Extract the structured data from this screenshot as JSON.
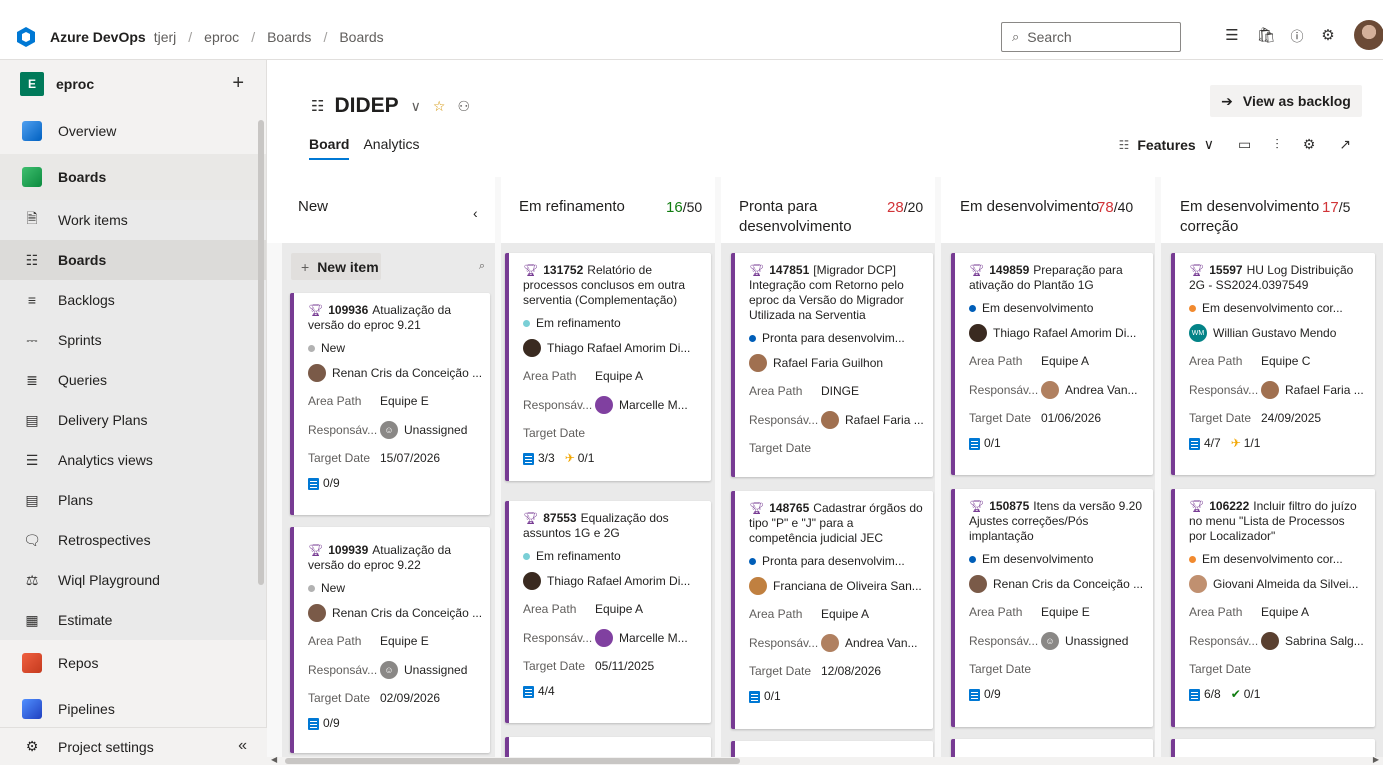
{
  "topbar": {
    "brand": "Azure DevOps",
    "breadcrumbs": [
      "tjerj",
      "eproc",
      "Boards",
      "Boards"
    ],
    "separator": "/",
    "search_placeholder": "Search"
  },
  "sidebar": {
    "project_badge": "E",
    "project_name": "eproc",
    "add_label": "+",
    "items": [
      {
        "label": "Overview",
        "icon": "overview-icon"
      },
      {
        "label": "Boards",
        "icon": "boards-icon"
      },
      {
        "label": "Work items",
        "icon": "work-items-icon"
      },
      {
        "label": "Boards",
        "icon": "boards-board-icon"
      },
      {
        "label": "Backlogs",
        "icon": "backlogs-icon"
      },
      {
        "label": "Sprints",
        "icon": "sprints-icon"
      },
      {
        "label": "Queries",
        "icon": "queries-icon"
      },
      {
        "label": "Delivery Plans",
        "icon": "delivery-plans-icon"
      },
      {
        "label": "Analytics views",
        "icon": "analytics-views-icon"
      },
      {
        "label": "Plans",
        "icon": "plans-icon"
      },
      {
        "label": "Retrospectives",
        "icon": "retrospectives-icon"
      },
      {
        "label": "Wiql Playground",
        "icon": "wiql-icon"
      },
      {
        "label": "Estimate",
        "icon": "estimate-icon"
      },
      {
        "label": "Repos",
        "icon": "repos-icon"
      },
      {
        "label": "Pipelines",
        "icon": "pipelines-icon"
      }
    ],
    "project_settings": "Project settings",
    "collapse": "«"
  },
  "header": {
    "board_name": "DIDEP",
    "tabs": [
      "Board",
      "Analytics"
    ],
    "view_as_backlog": "View as backlog",
    "features_label": "Features"
  },
  "columns": [
    {
      "name": "New",
      "count": "",
      "limit": "",
      "collapse": "‹"
    },
    {
      "name": "Em refinamento",
      "count": "16",
      "limit": "/50"
    },
    {
      "name": "Pronta para desenvolvimento",
      "count": "28",
      "limit": "/20"
    },
    {
      "name": "Em desenvolvimento",
      "count": "78",
      "limit": "/40"
    },
    {
      "name": "Em desenvolvimento correção",
      "count": "17",
      "limit": "/5"
    }
  ],
  "new_item_label": "New item",
  "field_labels": {
    "area": "Area Path",
    "resp": "Responsáv...",
    "target": "Target Date"
  },
  "cards": {
    "c1": {
      "id": "109936",
      "title": "Atualização da versão do eproc 9.21",
      "state": "New",
      "assigned": "Renan Cris da Conceição ...",
      "area": "Equipe E",
      "resp": "Unassigned",
      "target": "15/07/2026",
      "tasks": "0/9"
    },
    "c2": {
      "id": "109939",
      "title": "Atualização da versão do eproc 9.22",
      "state": "New",
      "assigned": "Renan Cris da Conceição ...",
      "area": "Equipe E",
      "resp": "Unassigned",
      "target": "02/09/2026",
      "tasks": "0/9"
    },
    "c3": {
      "id": "131752",
      "title": "Relatório de processos conclusos em outra serventia (Complementação)",
      "state": "Em refinamento",
      "assigned": "Thiago Rafael Amorim Di...",
      "area": "Equipe A",
      "resp": "Marcelle M...",
      "target": "",
      "tasks": "3/3",
      "extra": "0/1"
    },
    "c4": {
      "id": "87553",
      "title": "Equalização dos assuntos 1G e 2G",
      "state": "Em refinamento",
      "assigned": "Thiago Rafael Amorim Di...",
      "area": "Equipe A",
      "resp": "Marcelle M...",
      "target": "05/11/2025",
      "tasks": "4/4"
    },
    "c5": {
      "id": "147851",
      "title": "[Migrador DCP] Integração com Retorno pelo eproc da Versão do Migrador Utilizada na Serventia",
      "state": "Pronta para desenvolvim...",
      "assigned": "Rafael Faria Guilhon",
      "area": "DINGE",
      "resp": "Rafael Faria ...",
      "target": ""
    },
    "c6": {
      "id": "148765",
      "title": "Cadastrar órgãos do tipo \"P\" e \"J\" para a competência judicial JEC",
      "state": "Pronta para desenvolvim...",
      "assigned": "Franciana de Oliveira San...",
      "area": "Equipe A",
      "resp": "Andrea Van...",
      "target": "12/08/2026",
      "tasks": "0/1"
    },
    "c7": {
      "id": "149859",
      "title": "Preparação para ativação do Plantão 1G",
      "state": "Em desenvolvimento",
      "assigned": "Thiago Rafael Amorim Di...",
      "area": "Equipe A",
      "resp": "Andrea Van...",
      "target": "01/06/2026",
      "tasks": "0/1"
    },
    "c8": {
      "id": "150875",
      "title": "Itens da versão 9.20 Ajustes correções/Pós implantação",
      "state": "Em desenvolvimento",
      "assigned": "Renan Cris da Conceição ...",
      "area": "Equipe E",
      "resp": "Unassigned",
      "target": "",
      "tasks": "0/9"
    },
    "c9": {
      "id": "15597",
      "title": "HU Log Distribuição 2G - SS2024.0397549",
      "state": "Em desenvolvimento cor...",
      "assigned": "Willian Gustavo Mendo",
      "assigned_initials": "WM",
      "area": "Equipe C",
      "resp": "Rafael Faria ...",
      "target": "24/09/2025",
      "tasks": "4/7",
      "extra": "1/1"
    },
    "c10": {
      "id": "106222",
      "title": "Incluir filtro do juízo no menu \"Lista de Processos por Localizador\"",
      "state": "Em desenvolvimento cor...",
      "assigned": "Giovani Almeida da Silvei...",
      "area": "Equipe A",
      "resp": "Sabrina Salg...",
      "target": "",
      "tasks": "6/8",
      "extra": "0/1"
    }
  },
  "colors": {
    "accent": "#0078d4",
    "feature": "#773b93",
    "over_limit": "#d13438",
    "under_limit": "#107c10",
    "state_new": "#b2b2b2",
    "state_refinamento": "#7acfd6",
    "state_pronta": "#005eb8",
    "state_dev": "#005eb8",
    "state_correcao": "#f18a2f"
  }
}
